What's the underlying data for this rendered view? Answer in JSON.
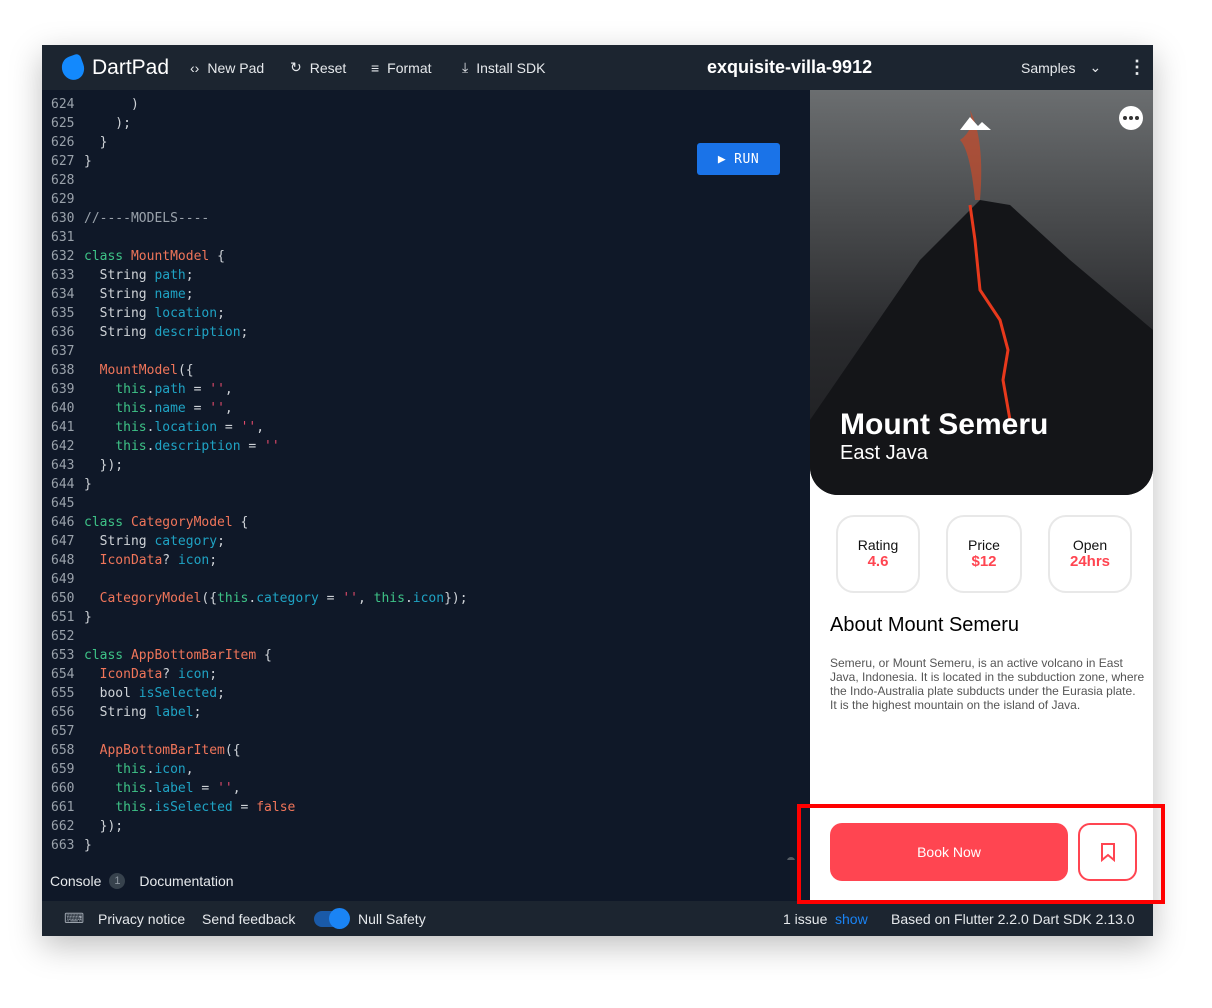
{
  "header": {
    "logo": "DartPad",
    "new_pad": "New Pad",
    "reset": "Reset",
    "format": "Format",
    "install_sdk": "Install SDK",
    "title": "exquisite-villa-9912",
    "samples": "Samples"
  },
  "editor": {
    "run_label": "RUN",
    "lines": [
      {
        "n": "624",
        "t": [
          [
            "",
            "      )"
          ]
        ]
      },
      {
        "n": "625",
        "t": [
          [
            "",
            "    );"
          ]
        ]
      },
      {
        "n": "626",
        "t": [
          [
            "",
            "  }"
          ]
        ]
      },
      {
        "n": "627",
        "t": [
          [
            "",
            "}"
          ]
        ]
      },
      {
        "n": "628",
        "t": []
      },
      {
        "n": "629",
        "t": []
      },
      {
        "n": "630",
        "t": [
          [
            "cm",
            "//----MODELS----"
          ]
        ]
      },
      {
        "n": "631",
        "t": []
      },
      {
        "n": "632",
        "t": [
          [
            "k",
            "class"
          ],
          [
            "",
            " "
          ],
          [
            "c",
            "MountModel"
          ],
          [
            "",
            " {"
          ]
        ]
      },
      {
        "n": "633",
        "t": [
          [
            "",
            "  String "
          ],
          [
            "f",
            "path"
          ],
          [
            "",
            ";"
          ]
        ]
      },
      {
        "n": "634",
        "t": [
          [
            "",
            "  String "
          ],
          [
            "f",
            "name"
          ],
          [
            "",
            ";"
          ]
        ]
      },
      {
        "n": "635",
        "t": [
          [
            "",
            "  String "
          ],
          [
            "f",
            "location"
          ],
          [
            "",
            ";"
          ]
        ]
      },
      {
        "n": "636",
        "t": [
          [
            "",
            "  String "
          ],
          [
            "f",
            "description"
          ],
          [
            "",
            ";"
          ]
        ]
      },
      {
        "n": "637",
        "t": []
      },
      {
        "n": "638",
        "t": [
          [
            "",
            "  "
          ],
          [
            "c",
            "MountModel"
          ],
          [
            "",
            "({"
          ]
        ]
      },
      {
        "n": "639",
        "t": [
          [
            "",
            "    "
          ],
          [
            "k",
            "this"
          ],
          [
            "",
            "."
          ],
          [
            "f",
            "path"
          ],
          [
            "",
            " = "
          ],
          [
            "s",
            "''"
          ],
          [
            "",
            ","
          ]
        ]
      },
      {
        "n": "640",
        "t": [
          [
            "",
            "    "
          ],
          [
            "k",
            "this"
          ],
          [
            "",
            "."
          ],
          [
            "f",
            "name"
          ],
          [
            "",
            " = "
          ],
          [
            "s",
            "''"
          ],
          [
            "",
            ","
          ]
        ]
      },
      {
        "n": "641",
        "t": [
          [
            "",
            "    "
          ],
          [
            "k",
            "this"
          ],
          [
            "",
            "."
          ],
          [
            "f",
            "location"
          ],
          [
            "",
            " = "
          ],
          [
            "s",
            "''"
          ],
          [
            "",
            ","
          ]
        ]
      },
      {
        "n": "642",
        "t": [
          [
            "",
            "    "
          ],
          [
            "k",
            "this"
          ],
          [
            "",
            "."
          ],
          [
            "f",
            "description"
          ],
          [
            "",
            " = "
          ],
          [
            "s",
            "''"
          ]
        ]
      },
      {
        "n": "643",
        "t": [
          [
            "",
            "  });"
          ]
        ]
      },
      {
        "n": "644",
        "t": [
          [
            "",
            "}"
          ]
        ]
      },
      {
        "n": "645",
        "t": []
      },
      {
        "n": "646",
        "t": [
          [
            "k",
            "class"
          ],
          [
            "",
            " "
          ],
          [
            "c",
            "CategoryModel"
          ],
          [
            "",
            " {"
          ]
        ]
      },
      {
        "n": "647",
        "t": [
          [
            "",
            "  String "
          ],
          [
            "f",
            "category"
          ],
          [
            "",
            ";"
          ]
        ]
      },
      {
        "n": "648",
        "t": [
          [
            "",
            "  "
          ],
          [
            "c",
            "IconData"
          ],
          [
            "",
            "? "
          ],
          [
            "f",
            "icon"
          ],
          [
            "",
            ";"
          ]
        ]
      },
      {
        "n": "649",
        "t": []
      },
      {
        "n": "650",
        "t": [
          [
            "",
            "  "
          ],
          [
            "c",
            "CategoryModel"
          ],
          [
            "",
            "({"
          ],
          [
            "k",
            "this"
          ],
          [
            "",
            "."
          ],
          [
            "f",
            "category"
          ],
          [
            "",
            " = "
          ],
          [
            "s",
            "''"
          ],
          [
            "",
            ", "
          ],
          [
            "k",
            "this"
          ],
          [
            "",
            "."
          ],
          [
            "f",
            "icon"
          ],
          [
            "",
            "});"
          ]
        ]
      },
      {
        "n": "651",
        "t": [
          [
            "",
            "}"
          ]
        ]
      },
      {
        "n": "652",
        "t": []
      },
      {
        "n": "653",
        "t": [
          [
            "k",
            "class"
          ],
          [
            "",
            " "
          ],
          [
            "c",
            "AppBottomBarItem"
          ],
          [
            "",
            " {"
          ]
        ]
      },
      {
        "n": "654",
        "t": [
          [
            "",
            "  "
          ],
          [
            "c",
            "IconData"
          ],
          [
            "",
            "? "
          ],
          [
            "f",
            "icon"
          ],
          [
            "",
            ";"
          ]
        ]
      },
      {
        "n": "655",
        "t": [
          [
            "",
            "  bool "
          ],
          [
            "f",
            "isSelected"
          ],
          [
            "",
            ";"
          ]
        ]
      },
      {
        "n": "656",
        "t": [
          [
            "",
            "  String "
          ],
          [
            "f",
            "label"
          ],
          [
            "",
            ";"
          ]
        ]
      },
      {
        "n": "657",
        "t": []
      },
      {
        "n": "658",
        "t": [
          [
            "",
            "  "
          ],
          [
            "c",
            "AppBottomBarItem"
          ],
          [
            "",
            "({"
          ]
        ]
      },
      {
        "n": "659",
        "t": [
          [
            "",
            "    "
          ],
          [
            "k",
            "this"
          ],
          [
            "",
            "."
          ],
          [
            "f",
            "icon"
          ],
          [
            "",
            ","
          ]
        ]
      },
      {
        "n": "660",
        "t": [
          [
            "",
            "    "
          ],
          [
            "k",
            "this"
          ],
          [
            "",
            "."
          ],
          [
            "f",
            "label"
          ],
          [
            "",
            " = "
          ],
          [
            "s",
            "''"
          ],
          [
            "",
            ","
          ]
        ]
      },
      {
        "n": "661",
        "t": [
          [
            "",
            "    "
          ],
          [
            "k",
            "this"
          ],
          [
            "",
            "."
          ],
          [
            "f",
            "isSelected"
          ],
          [
            "",
            " = "
          ],
          [
            "c",
            "false"
          ]
        ]
      },
      {
        "n": "662",
        "t": [
          [
            "",
            "  });"
          ]
        ]
      },
      {
        "n": "663",
        "t": [
          [
            "",
            "}"
          ]
        ]
      }
    ]
  },
  "console": {
    "label": "Console",
    "count": "1",
    "documentation": "Documentation"
  },
  "footer": {
    "privacy": "Privacy notice",
    "feedback": "Send feedback",
    "null_safety": "Null Safety",
    "null_safety_on": true,
    "issues": "1 issue",
    "show": "show",
    "version": "Based on Flutter 2.2.0 Dart SDK 2.13.0"
  },
  "app": {
    "name": "Mount Semeru",
    "location": "East Java",
    "stats": [
      {
        "label": "Rating",
        "value": "4.6"
      },
      {
        "label": "Price",
        "value": "$12"
      },
      {
        "label": "Open",
        "value": "24hrs"
      }
    ],
    "about_title": "About Mount Semeru",
    "description": "Semeru, or Mount Semeru, is an active volcano in East Java, Indonesia. It is located in the subduction zone, where the Indo-Australia plate subducts under the Eurasia plate. It is the highest mountain on the island of Java.",
    "book_label": "Book Now",
    "accent": "#ff4551"
  }
}
